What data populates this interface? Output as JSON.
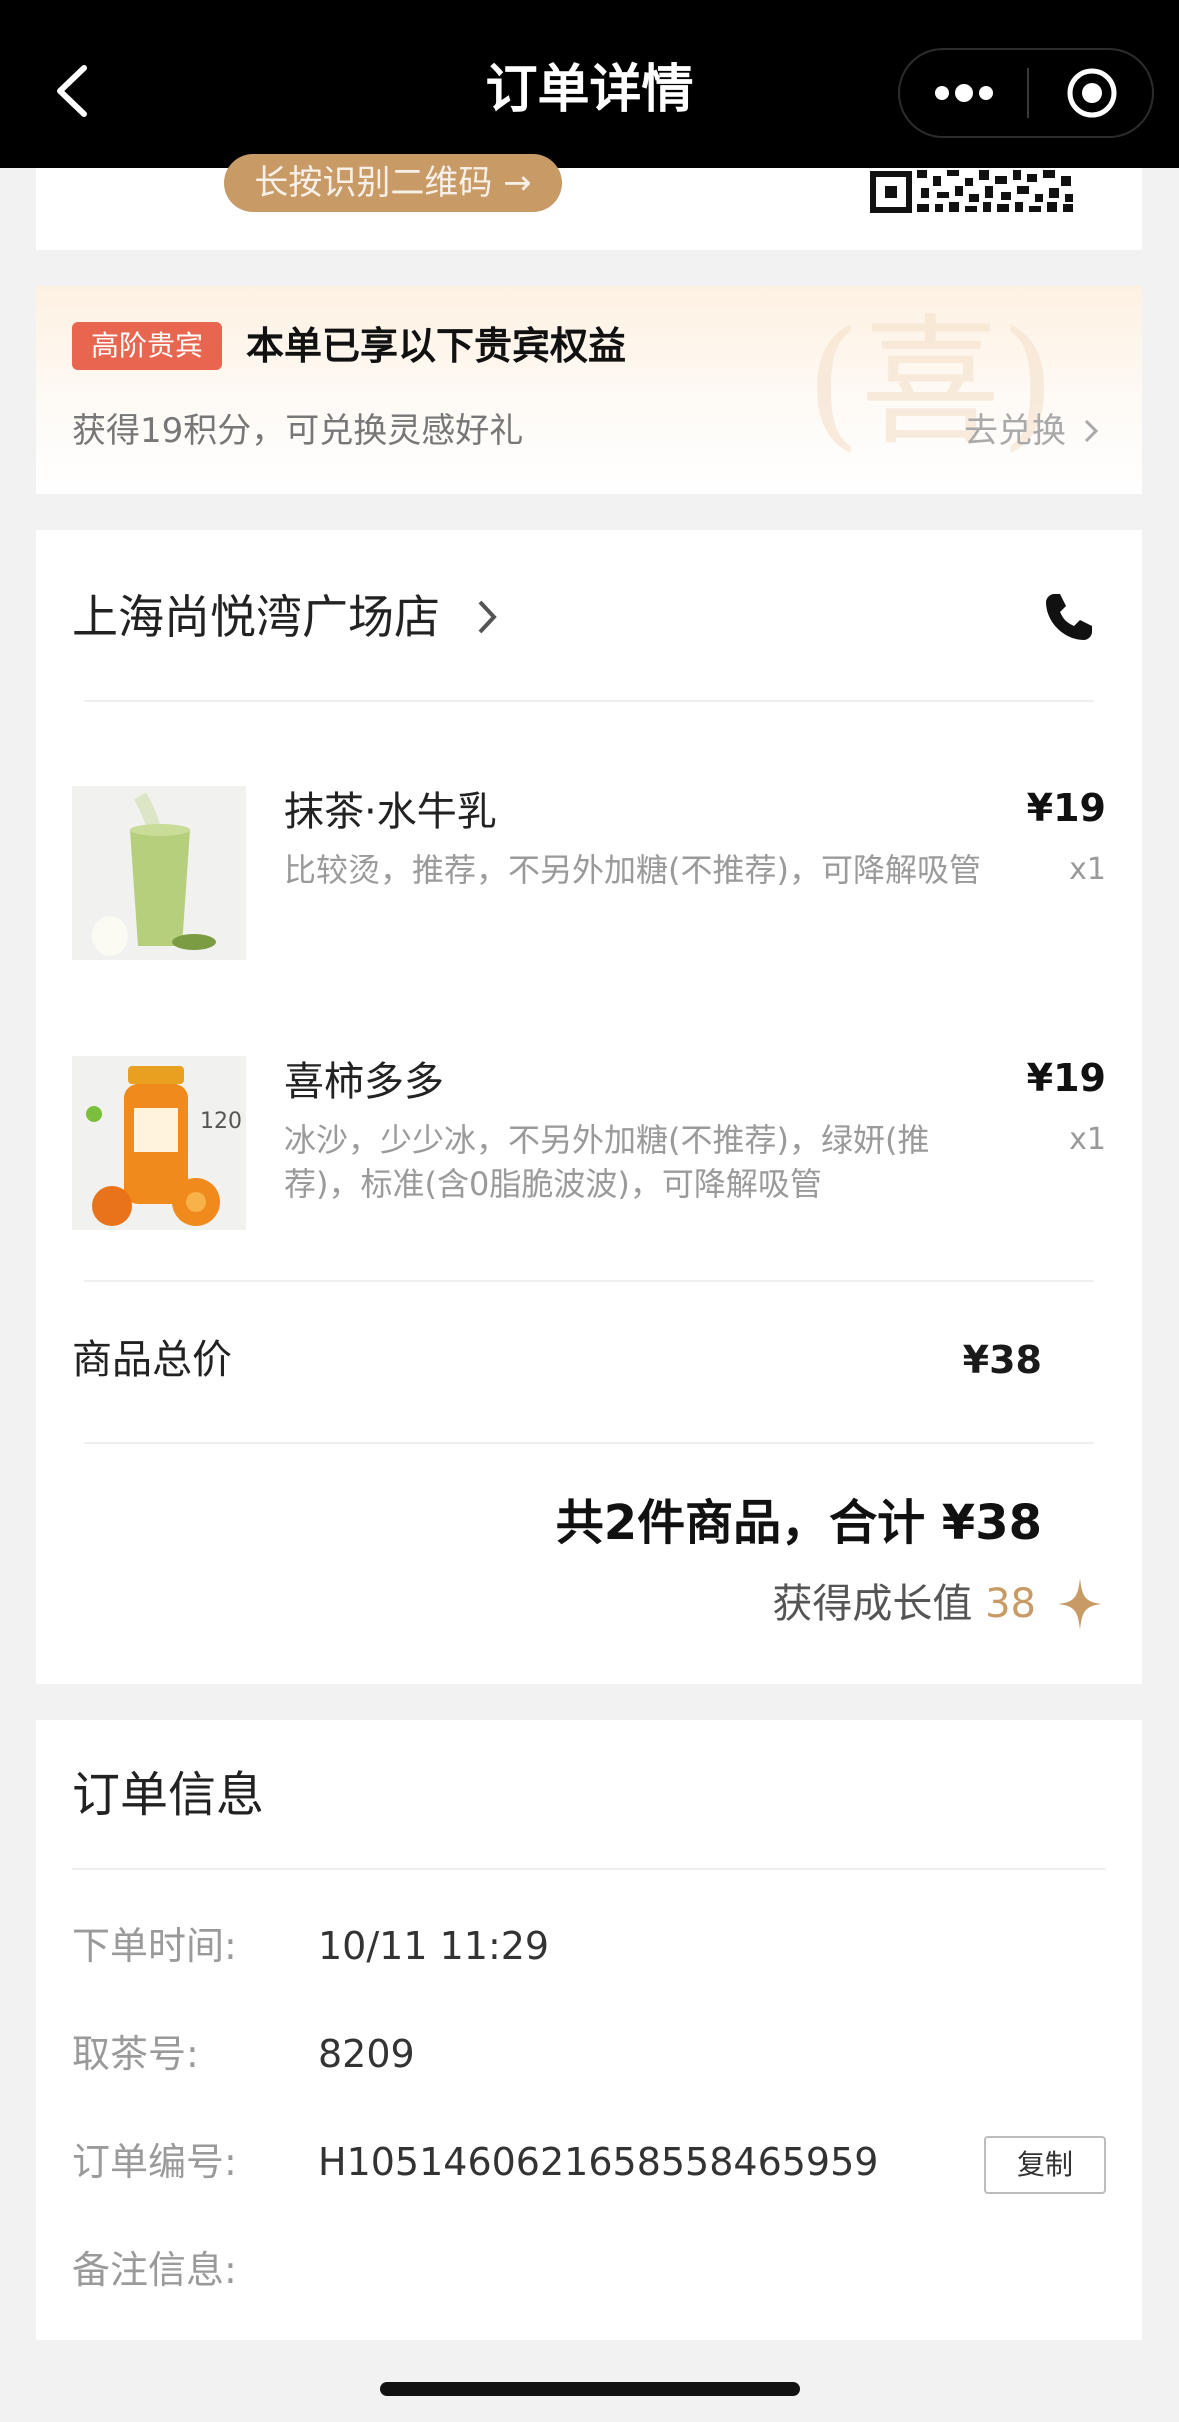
{
  "header": {
    "title": "订单详情"
  },
  "qr": {
    "button_label": "长按识别二维码 →"
  },
  "vip": {
    "badge": "高阶贵宾",
    "title": "本单已享以下贵宾权益",
    "subtitle": "获得19积分，可兑换灵感好礼",
    "link": "去兑换",
    "watermark": "(喜)"
  },
  "store": {
    "name": "上海尚悦湾广场店"
  },
  "products": [
    {
      "name": "抹茶·水牛乳",
      "desc": "比较烫，推荐，不另外加糖(不推荐)，可降解吸管",
      "price": "¥19",
      "qty": "x1"
    },
    {
      "name": "喜柿多多",
      "desc": "冰沙，少少冰，不另外加糖(不推荐)，绿妍(推荐)，标准(含0脂脆波波)，可降解吸管",
      "price": "¥19",
      "qty": "x1"
    }
  ],
  "totals": {
    "label": "商品总价",
    "value": "¥38",
    "summary": "共2件商品，合计 ¥38",
    "growth_label": "获得成长值",
    "growth_value": "38"
  },
  "order_info": {
    "title": "订单信息",
    "fields": [
      {
        "label": "下单时间:",
        "value": "10/11 11:29"
      },
      {
        "label": "取茶号:",
        "value": "8209"
      },
      {
        "label": "订单编号:",
        "value": "H1051460621658558465959"
      },
      {
        "label": "备注信息:",
        "value": ""
      }
    ],
    "copy_label": "复制"
  },
  "colors": {
    "accent_gold": "#c89a66",
    "badge_red": "#e8664f",
    "header_bg": "#000000"
  }
}
